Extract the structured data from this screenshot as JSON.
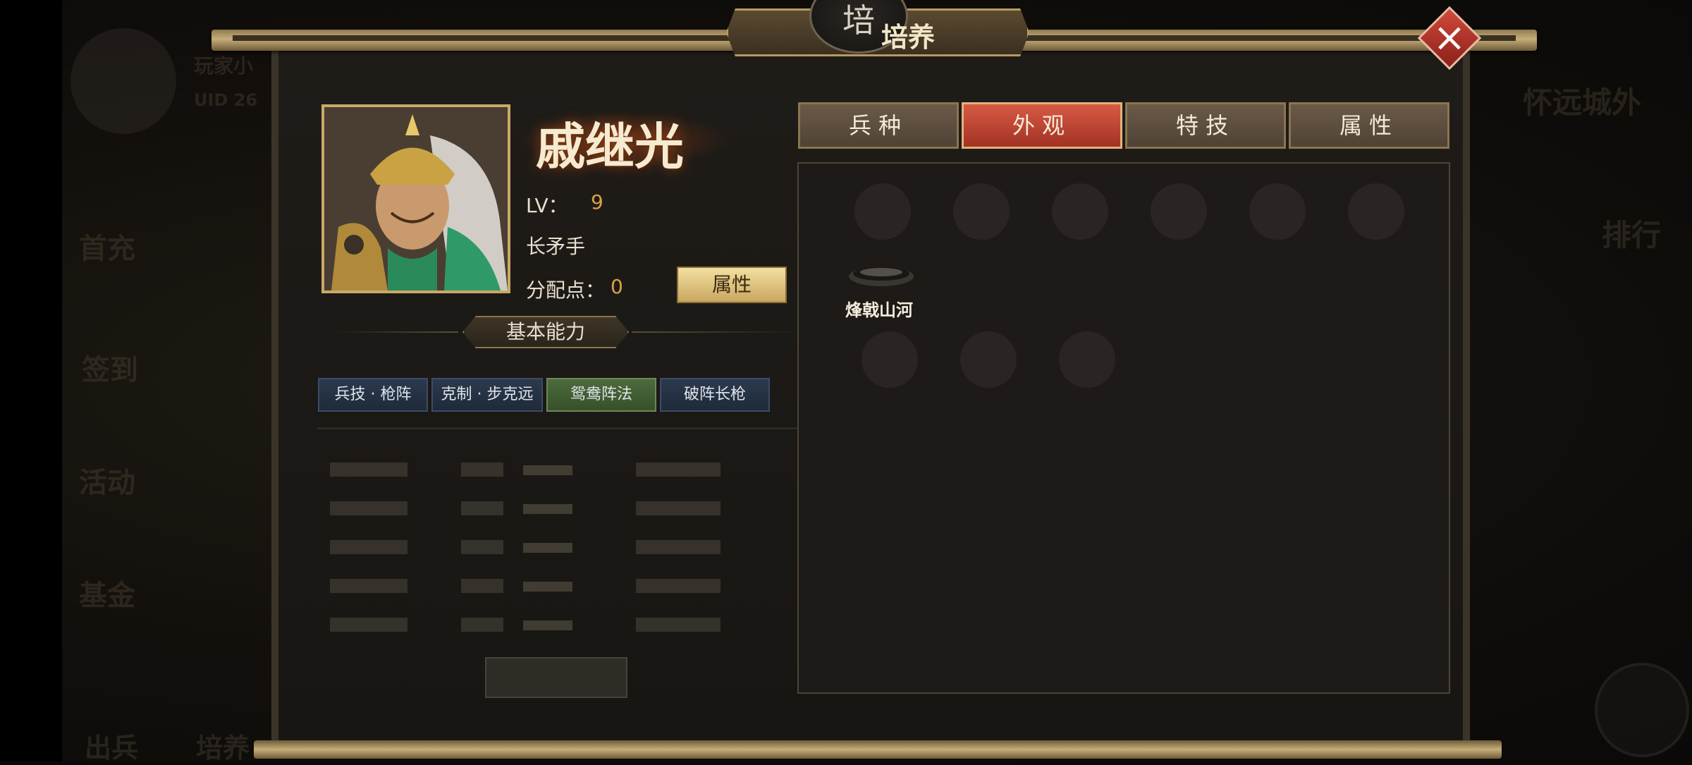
{
  "window": {
    "title": "培养",
    "emblem_glyph": "培"
  },
  "background": {
    "player_name": "玩家小",
    "uid": "UID 26",
    "location": "怀远城外",
    "side_menu": [
      "首充",
      "签到",
      "活动",
      "基金"
    ],
    "bottom_menu": [
      "出兵",
      "培养"
    ],
    "right_menu": [
      "排行"
    ]
  },
  "hero": {
    "name": "戚继光",
    "level_label": "LV：",
    "level": "9",
    "troop_type": "长矛手",
    "points_label": "分配点：",
    "points": "0",
    "attr_button": "属性",
    "section_title": "基本能力"
  },
  "skills": [
    "兵技 · 枪阵",
    "克制 · 步克远",
    "鸳鸯阵法",
    "破阵长枪"
  ],
  "tabs": [
    {
      "label": "兵种",
      "active": false
    },
    {
      "label": "外观",
      "active": true
    },
    {
      "label": "特技",
      "active": false
    },
    {
      "label": "属性",
      "active": false
    }
  ],
  "skins": [
    {
      "label": "烽戟山河"
    }
  ],
  "colors": {
    "accent_gold": "#c9a968",
    "active_tab": "#c8473a",
    "value_orange": "#d9a243",
    "close_red": "#c0392b"
  }
}
